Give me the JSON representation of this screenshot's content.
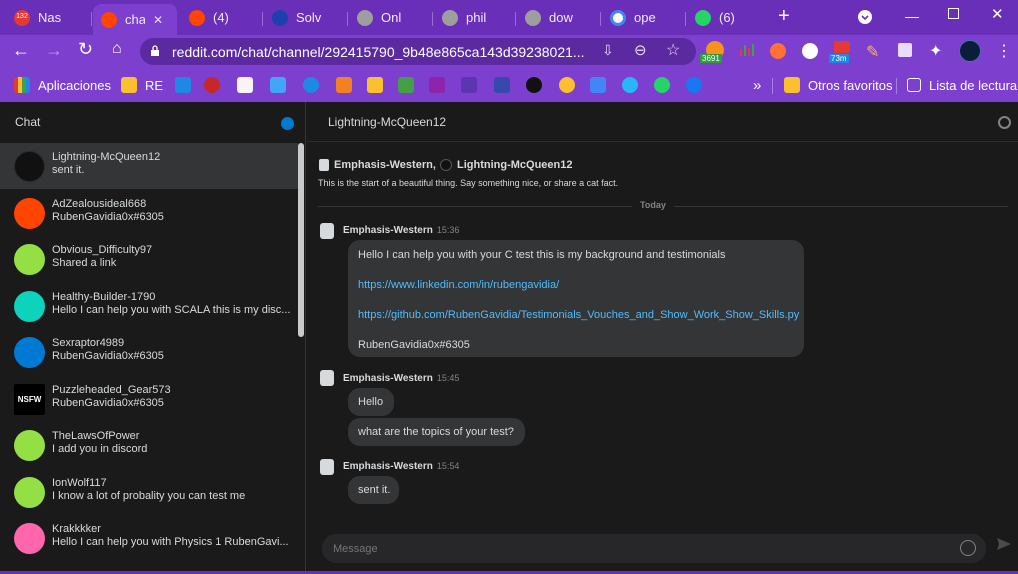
{
  "browser": {
    "tabs": [
      {
        "title": "Nas",
        "badge": "132",
        "color": "#e53935"
      },
      {
        "title": "chat",
        "color": "#ff4500",
        "active": true
      },
      {
        "title": "(4)",
        "color": "#ff4500"
      },
      {
        "title": "Solv",
        "color": "#1e40af"
      },
      {
        "title": "Onl",
        "color": "#9e9e9e"
      },
      {
        "title": "phil",
        "color": "#9e9e9e"
      },
      {
        "title": "dow",
        "color": "#9e9e9e"
      },
      {
        "title": "ope",
        "color": "#4285f4"
      },
      {
        "title": "(6)",
        "color": "#25d366"
      }
    ],
    "new_tab": "+",
    "url": "reddit.com/chat/channel/292415790_9b48e865ca143d39238021...",
    "bookmarks": {
      "apps": "Aplicaciones",
      "re": "RE",
      "more": "»",
      "other": "Otros favoritos",
      "reading": "Lista de lectura"
    },
    "ext_badge_1": "3691",
    "ext_badge_2": "73m"
  },
  "sidebar": {
    "title": "Chat",
    "conversations": [
      {
        "name": "Lightning-McQueen12",
        "preview": "sent it.",
        "avatar_color": "#1a1a1b",
        "selected": true
      },
      {
        "name": "AdZealousideal668",
        "preview": "RubenGavidia0x#6305",
        "avatar_color": "#ff4500"
      },
      {
        "name": "Obvious_Difficulty97",
        "preview": "Shared a link",
        "avatar_color": "#94e044"
      },
      {
        "name": "Healthy-Builder-1790",
        "preview": "Hello I can help you with SCALA this is my disc...",
        "avatar_color": "#0dd3bb"
      },
      {
        "name": "Sexraptor4989",
        "preview": "RubenGavidia0x#6305",
        "avatar_color": "#0079d3"
      },
      {
        "name": "Puzzleheaded_Gear573",
        "preview": "RubenGavidia0x#6305",
        "avatar_color": "#000000",
        "nsfw": "NSFW"
      },
      {
        "name": "TheLawsOfPower",
        "preview": "I add you in discord",
        "avatar_color": "#94e044"
      },
      {
        "name": "IonWolf117",
        "preview": "I know a lot of probality you can test me",
        "avatar_color": "#94e044"
      },
      {
        "name": "Krakkkker",
        "preview": "Hello I can help you with Physics 1 RubenGavi...",
        "avatar_color": "#ff66ac"
      }
    ]
  },
  "main": {
    "channel_title": "Lightning-McQueen12",
    "members_a": "Emphasis-Western,",
    "members_b": "Lightning-McQueen12",
    "intro": "This is the start of a beautiful thing. Say something nice, or share a cat fact.",
    "divider": "Today",
    "groups": [
      {
        "sender": "Emphasis-Western",
        "time": "15:36",
        "lines": [
          "Hello I can help you with your C test this is my background and testimonials",
          "https://www.linkedin.com/in/rubengavidia/",
          "https://github.com/RubenGavidia/Testimonials_Vouches_and_Show_Work_Show_Skills.py",
          "RubenGavidia0x#6305"
        ]
      },
      {
        "sender": "Emphasis-Western",
        "time": "15:45",
        "messages": [
          "Hello",
          "what are the topics of your test?"
        ]
      },
      {
        "sender": "Emphasis-Western",
        "time": "15:54",
        "messages": [
          "sent it."
        ]
      }
    ],
    "input_placeholder": "Message"
  }
}
